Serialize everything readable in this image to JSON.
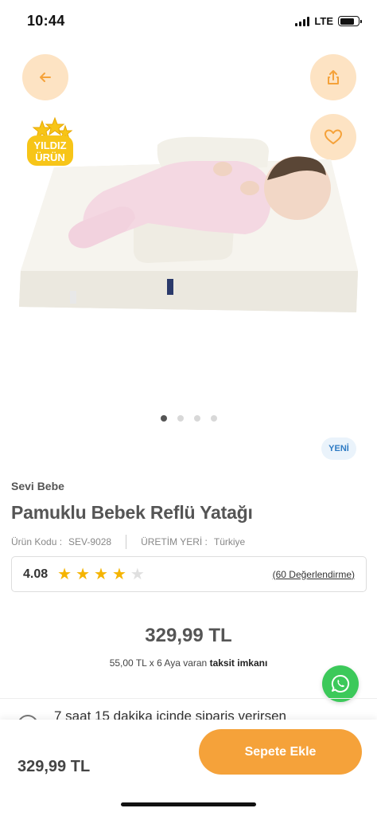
{
  "status_bar": {
    "time": "10:44",
    "network": "LTE"
  },
  "header": {
    "back_icon": "arrow-left-icon",
    "share_icon": "share-icon",
    "favorite_icon": "heart-icon"
  },
  "badge": {
    "line1": "YILDIZ",
    "line2": "ÜRÜN"
  },
  "gallery": {
    "total": 4,
    "active_index": 0
  },
  "product": {
    "new_label": "YENİ",
    "brand": "Sevi Bebe",
    "title": "Pamuklu Bebek Reflü Yatağı",
    "code_label": "Ürün Kodu :",
    "code_value": "SEV-9028",
    "origin_label": "ÜRETİM YERİ :",
    "origin_value": "Türkiye"
  },
  "rating": {
    "value": "4.08",
    "stars_filled": 4,
    "stars_total": 5,
    "reviews_link": "(60 Değerlendirme)"
  },
  "price": {
    "main": "329,99 TL",
    "installment_prefix": "55,00 TL x 6 Aya varan",
    "installment_bold": "taksit imkanı"
  },
  "delivery": {
    "text": "7 saat 15 dakika içinde sipariş verirsen"
  },
  "bottom_bar": {
    "price": "329,99 TL",
    "cart_button": "Sepete Ekle"
  },
  "colors": {
    "accent": "#f5a23a",
    "circle_bg": "#fde3c3",
    "whatsapp": "#3cc95a",
    "star": "#f5b400"
  }
}
